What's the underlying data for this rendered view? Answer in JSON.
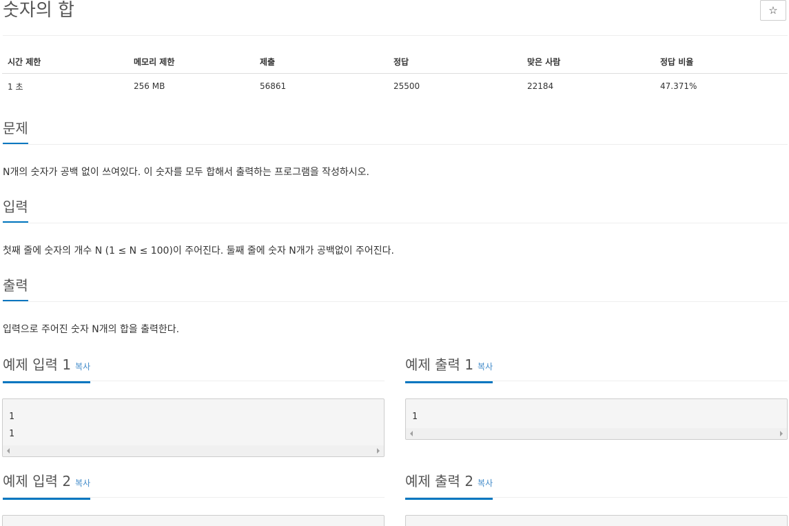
{
  "problem": {
    "title": "숫자의 합",
    "star_icon": "☆"
  },
  "info_table": {
    "headers": [
      "시간 제한",
      "메모리 제한",
      "제출",
      "정답",
      "맞은 사람",
      "정답 비율"
    ],
    "values": [
      "1 초",
      "256 MB",
      "56861",
      "25500",
      "22184",
      "47.371%"
    ]
  },
  "sections": {
    "problem": {
      "heading": "문제",
      "text": "N개의 숫자가 공백 없이 쓰여있다. 이 숫자를 모두 합해서 출력하는 프로그램을 작성하시오."
    },
    "input": {
      "heading": "입력",
      "text": "첫째 줄에 숫자의 개수 N (1 ≤ N ≤ 100)이 주어진다. 둘째 줄에 숫자 N개가 공백없이 주어진다."
    },
    "output": {
      "heading": "출력",
      "text": "입력으로 주어진 숫자 N개의 합을 출력한다."
    }
  },
  "examples": {
    "copy_label": "복사",
    "input1": {
      "heading": "예제 입력 1",
      "lines": [
        "1",
        "1"
      ]
    },
    "output1": {
      "heading": "예제 출력 1",
      "lines": [
        "1"
      ]
    },
    "input2": {
      "heading": "예제 입력 2"
    },
    "output2": {
      "heading": "예제 출력 2"
    }
  },
  "colors": {
    "accent_underline": "#0076c0",
    "copy_link": "#428bca"
  }
}
